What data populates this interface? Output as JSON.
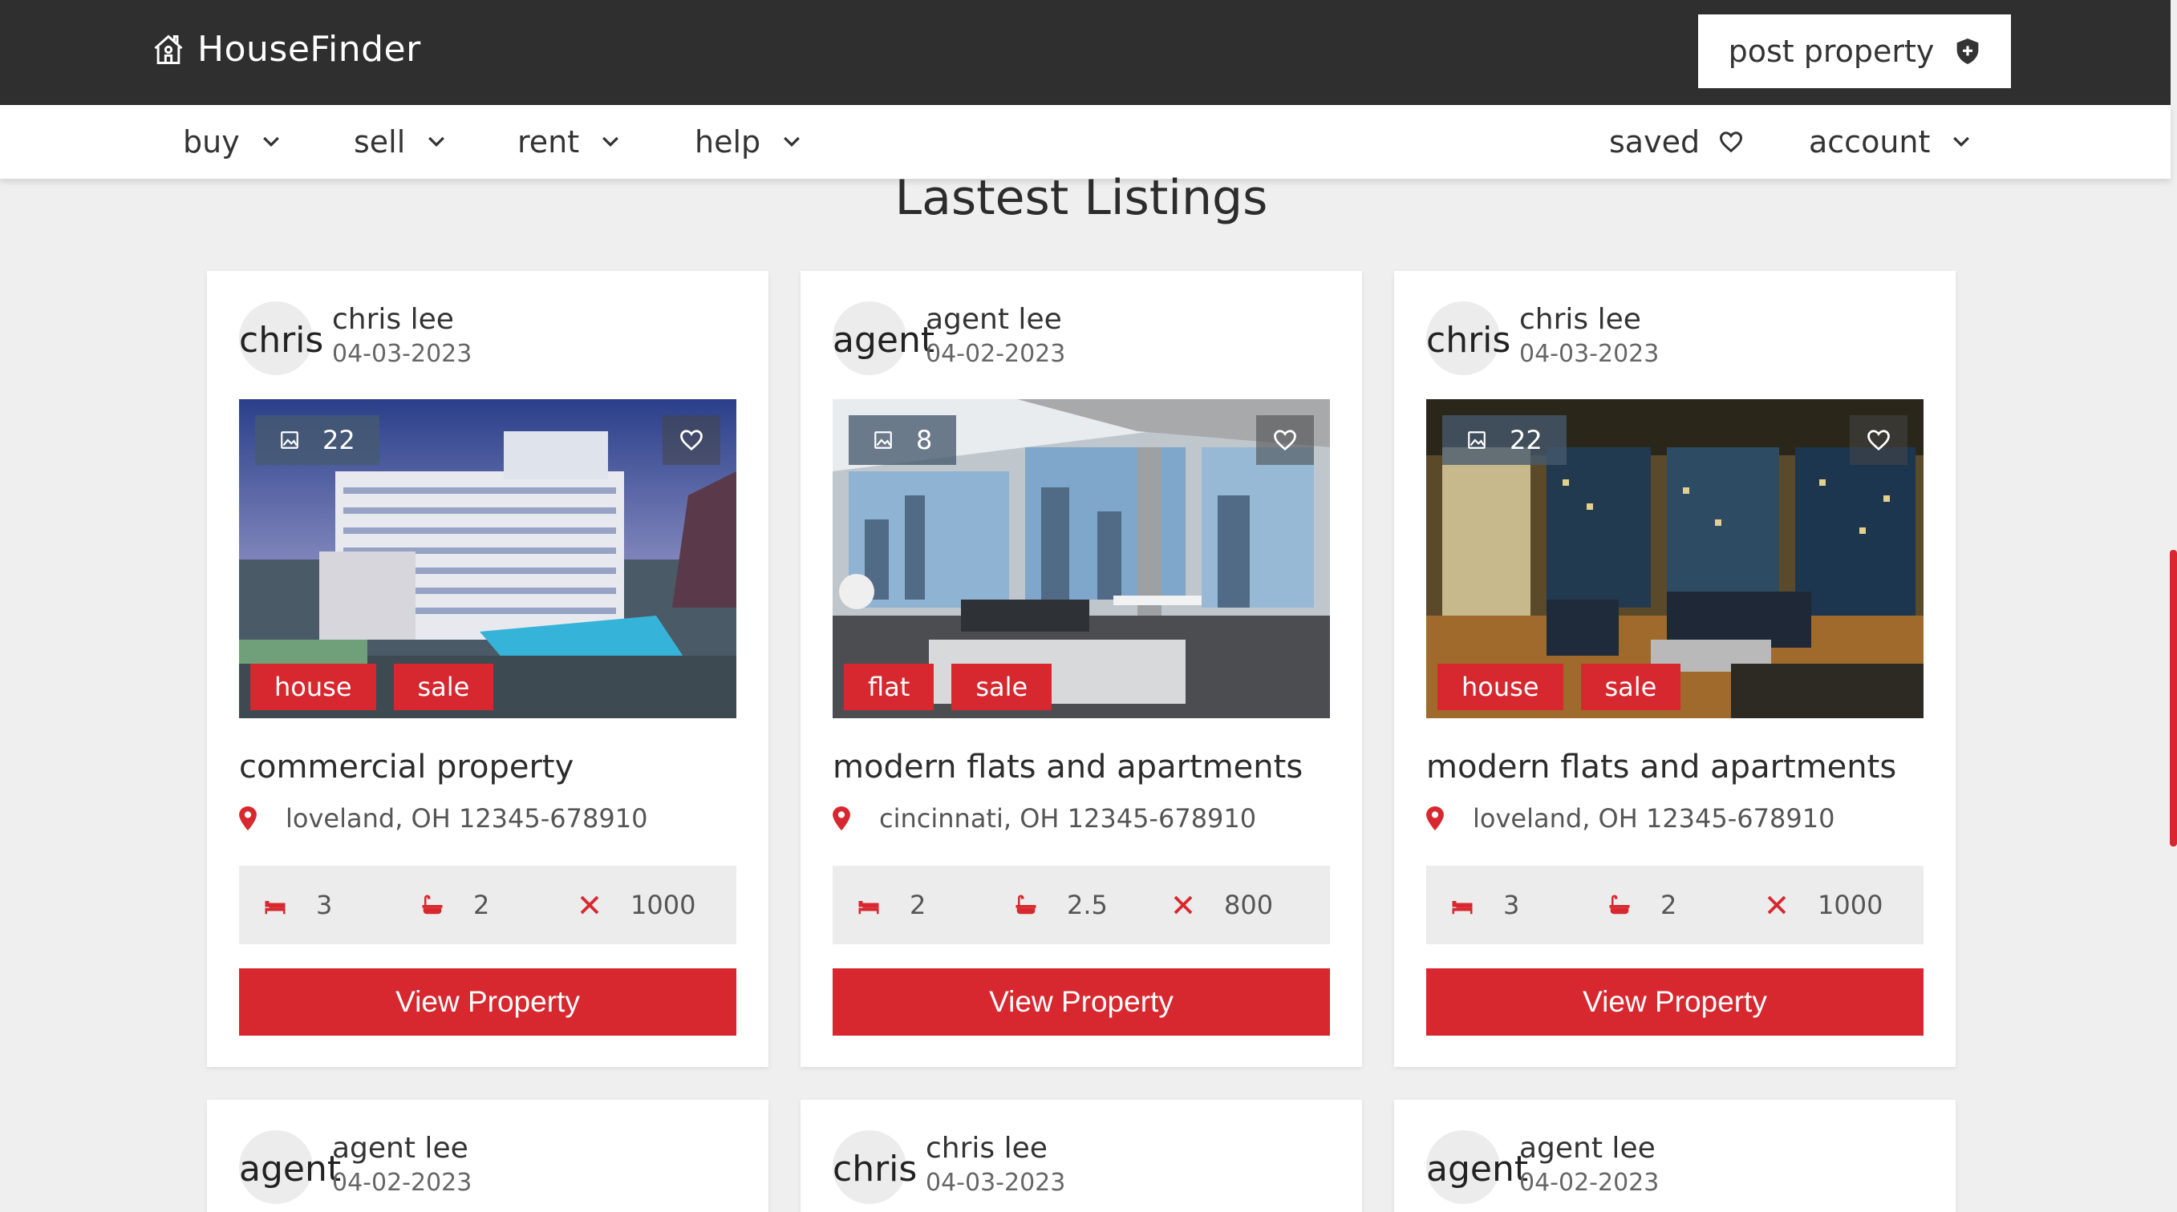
{
  "header": {
    "brand": "HouseFinder",
    "post_label": "post property"
  },
  "nav": {
    "left": [
      {
        "label": "buy"
      },
      {
        "label": "sell"
      },
      {
        "label": "rent"
      },
      {
        "label": "help"
      }
    ],
    "saved_label": "saved",
    "account_label": "account"
  },
  "main": {
    "heading": "Lastest Listings",
    "button_label": "View Property"
  },
  "listings": [
    {
      "avatar_text": "chris",
      "poster": "chris lee",
      "date": "04-03-2023",
      "photo_count": "22",
      "tags": [
        "house",
        "sale"
      ],
      "title": "commercial property",
      "address": "loveland, OH 12345-678910",
      "beds": "3",
      "baths": "2",
      "area": "1000"
    },
    {
      "avatar_text": "agent",
      "poster": "agent lee",
      "date": "04-02-2023",
      "photo_count": "8",
      "tags": [
        "flat",
        "sale"
      ],
      "title": "modern flats and apartments",
      "address": "cincinnati, OH 12345-678910",
      "beds": "2",
      "baths": "2.5",
      "area": "800"
    },
    {
      "avatar_text": "chris",
      "poster": "chris lee",
      "date": "04-03-2023",
      "photo_count": "22",
      "tags": [
        "house",
        "sale"
      ],
      "title": "modern flats and apartments",
      "address": "loveland, OH 12345-678910",
      "beds": "3",
      "baths": "2",
      "area": "1000"
    },
    {
      "avatar_text": "agent",
      "poster": "agent lee",
      "date": "04-02-2023"
    },
    {
      "avatar_text": "chris",
      "poster": "chris lee",
      "date": "04-03-2023"
    },
    {
      "avatar_text": "agent",
      "poster": "agent lee",
      "date": "04-02-2023"
    }
  ],
  "colors": {
    "accent": "#d7282f",
    "header_bg": "#2f2f2f",
    "page_bg": "#efefef"
  },
  "icons": {
    "brand": "house-icon",
    "post": "shield-icon",
    "dropdown": "chevron-down-icon",
    "saved": "heart-icon",
    "photos": "image-icon",
    "location": "map-pin-icon",
    "beds": "bed-icon",
    "baths": "bathtub-icon",
    "area": "area-icon"
  }
}
